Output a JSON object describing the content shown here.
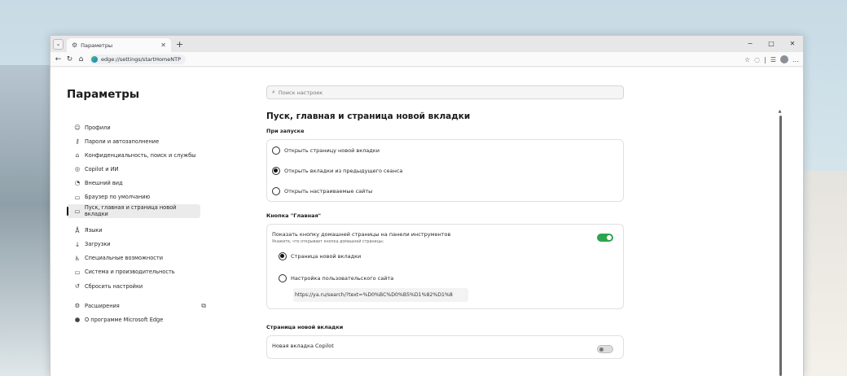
{
  "browser": {
    "tab_title": "Параметры",
    "new_tab_glyph": "+",
    "url": "edge://settings/startHomeNTP",
    "window_controls": [
      "−",
      "□",
      "✕"
    ]
  },
  "settings": {
    "title": "Параметры",
    "search_placeholder": "Поиск настроек",
    "sidebar": [
      {
        "label": "Профили",
        "icon": "user-icon"
      },
      {
        "label": "Пароли и автозаполнение",
        "icon": "key-icon"
      },
      {
        "label": "Конфиденциальность, поиск и службы",
        "icon": "lock-icon"
      },
      {
        "label": "Copilot и ИИ",
        "icon": "copilot-icon"
      },
      {
        "label": "Внешний вид",
        "icon": "palette-icon"
      },
      {
        "label": "Браузер по умолчанию",
        "icon": "browser-icon"
      },
      {
        "label": "Пуск, главная и страница новой вкладки",
        "icon": "home-icon",
        "active": true
      },
      {
        "label": "Языки",
        "icon": "language-icon"
      },
      {
        "label": "Загрузки",
        "icon": "download-icon"
      },
      {
        "label": "Специальные возможности",
        "icon": "accessibility-icon"
      },
      {
        "label": "Система и производительность",
        "icon": "system-icon"
      },
      {
        "label": "Сбросить настройки",
        "icon": "reset-icon"
      },
      {
        "label": "Расширения",
        "icon": "extensions-icon"
      },
      {
        "label": "О программе Microsoft Edge",
        "icon": "edge-icon"
      }
    ],
    "page_title": "Пуск, главная и страница новой вкладки",
    "startup": {
      "title": "При запуске",
      "options": [
        {
          "label": "Открыть страницу новой вкладки",
          "selected": false
        },
        {
          "label": "Открыть вкладки из предыдущего сеанса",
          "selected": true
        },
        {
          "label": "Открыть настраиваемые сайты",
          "selected": false
        }
      ]
    },
    "home": {
      "title": "Кнопка \"Главная\"",
      "toggle_label": "Показать кнопку домашней страницы на панели инструментов",
      "toggle_sub": "Укажите, что открывает кнопка домашней страницы:",
      "toggle_on": true,
      "options": [
        {
          "label": "Страница новой вкладки",
          "selected": true
        },
        {
          "label": "Настройка пользовательского сайта",
          "selected": false
        }
      ],
      "custom_url": "https://ya.ru/search/?text=%D0%BC%D0%B5%D1%82%D1%8"
    },
    "ntp": {
      "title": "Страница новой вкладки",
      "copilot_label": "Новая вкладка Copilot",
      "copilot_on": false
    }
  },
  "colors": {
    "accent_toggle": "#2da44e"
  }
}
